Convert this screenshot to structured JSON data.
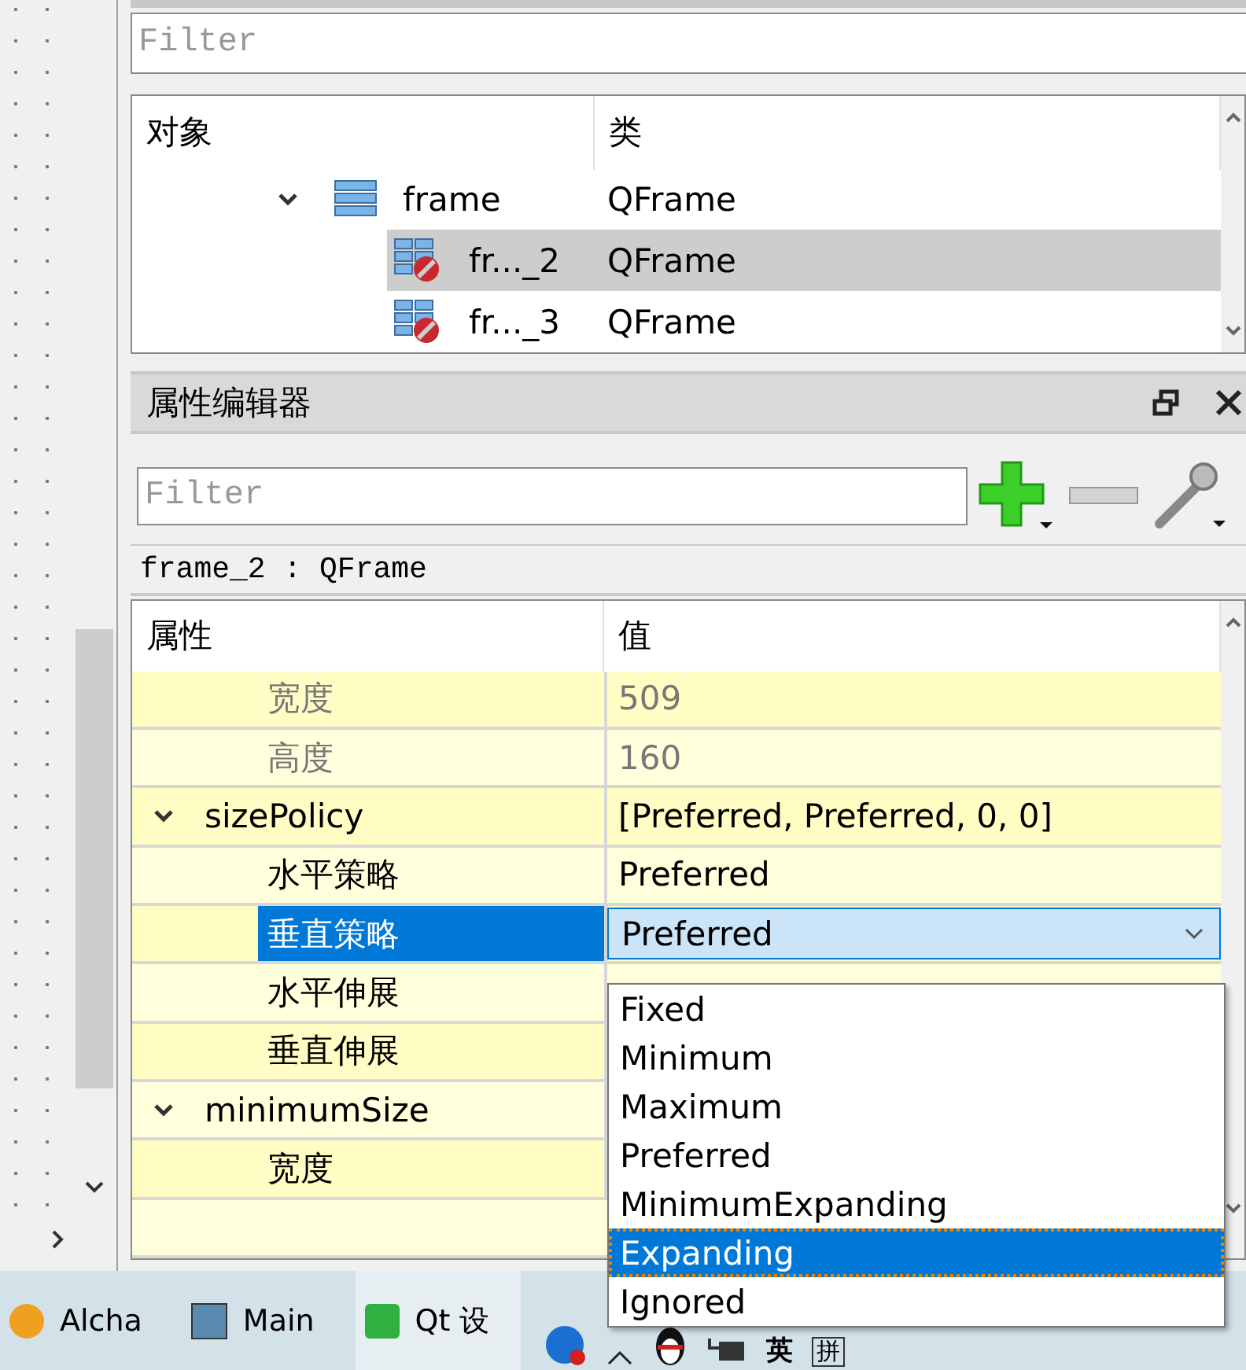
{
  "object_filter": {
    "placeholder": "Filter"
  },
  "object_tree": {
    "columns": [
      "对象",
      "类"
    ],
    "rows": [
      {
        "name": "frame",
        "class": "QFrame",
        "kind": "frame",
        "expanded": true,
        "selected": false,
        "children": [
          {
            "name": "fr..._2",
            "class": "QFrame",
            "kind": "blocked-frame",
            "selected": true
          },
          {
            "name": "fr..._3",
            "class": "QFrame",
            "kind": "blocked-frame",
            "selected": false
          }
        ]
      }
    ]
  },
  "property_editor": {
    "title": "属性编辑器",
    "filter": {
      "placeholder": "Filter"
    },
    "object_label": "frame_2 : QFrame",
    "columns": [
      "属性",
      "值"
    ],
    "rows": [
      {
        "children": [
          {
            "name": "宽度",
            "value": "509",
            "disabled": true,
            "selected": false
          },
          {
            "name": "高度",
            "value": "160",
            "disabled": true,
            "selected": false
          }
        ]
      },
      {
        "name": "sizePolicy",
        "value": "[Preferred, Preferred, 0, 0]",
        "expanded": true,
        "disabled": false,
        "selected": false,
        "children": [
          {
            "name": "水平策略",
            "value": "Preferred",
            "disabled": false,
            "selected": false
          },
          {
            "name": "垂直策略",
            "value": "Preferred",
            "disabled": false,
            "selected": true,
            "editing": true
          },
          {
            "name": "水平伸展",
            "disabled": false,
            "selected": false
          },
          {
            "name": "垂直伸展",
            "disabled": false,
            "selected": false
          }
        ]
      },
      {
        "name": "minimumSize",
        "expanded": true,
        "disabled": false,
        "selected": false,
        "children": [
          {
            "name": "宽度",
            "disabled": false,
            "selected": false
          }
        ]
      }
    ],
    "dropdown": {
      "options": [
        {
          "label": "Fixed",
          "selected": false
        },
        {
          "label": "Minimum",
          "selected": false
        },
        {
          "label": "Maximum",
          "selected": false
        },
        {
          "label": "Preferred",
          "selected": false
        },
        {
          "label": "MinimumExpanding",
          "selected": false
        },
        {
          "label": "Expanding",
          "selected": true
        },
        {
          "label": "Ignored",
          "selected": false
        }
      ]
    }
  },
  "taskbar": {
    "apps": [
      {
        "label": "Alcha"
      },
      {
        "label": "Main"
      },
      {
        "label": "Qt 设"
      }
    ],
    "tray": [
      {
        "label": "英"
      },
      {
        "label": "拼"
      }
    ]
  }
}
